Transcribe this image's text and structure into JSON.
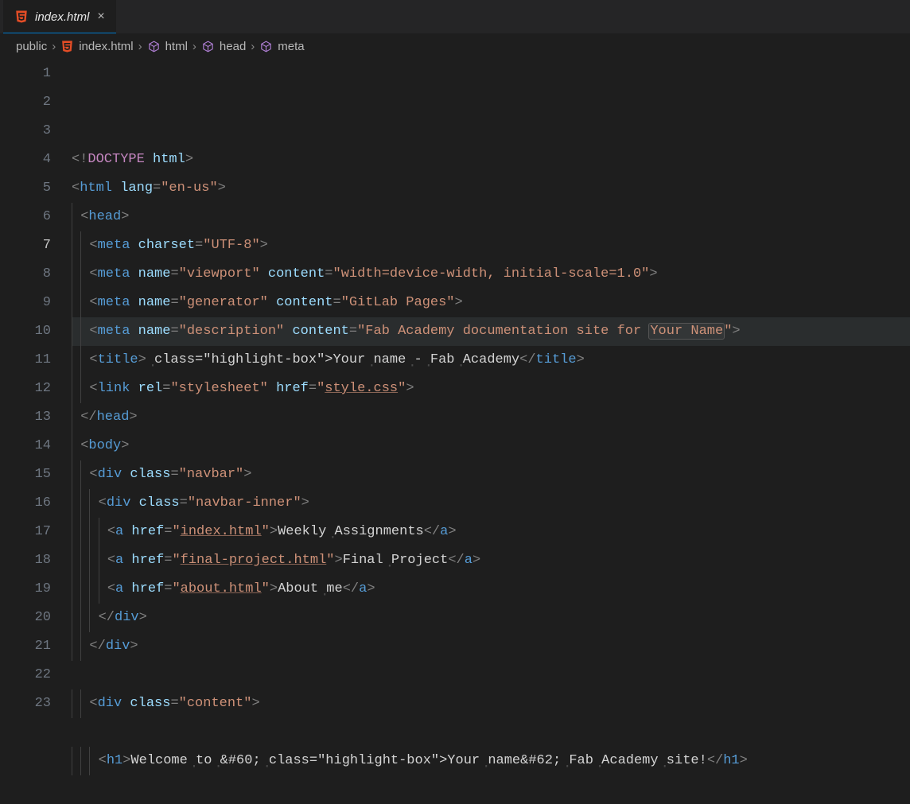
{
  "tabs": [
    {
      "name": "index.html"
    }
  ],
  "breadcrumb": [
    {
      "label": "public",
      "icon": null
    },
    {
      "label": "index.html",
      "icon": "html5"
    },
    {
      "label": "html",
      "icon": "cube"
    },
    {
      "label": "head",
      "icon": "cube"
    },
    {
      "label": "meta",
      "icon": "cube"
    }
  ],
  "gutter": [
    "1",
    "2",
    "3",
    "4",
    "5",
    "6",
    "7",
    "8",
    "9",
    "10",
    "11",
    "12",
    "13",
    "14",
    "15",
    "16",
    "17",
    "18",
    "19",
    "20",
    "21",
    "22",
    "23"
  ],
  "code": {
    "l1": {
      "raw": "<!DOCTYPE html>"
    },
    "l2": {
      "raw": "<html lang=\"en-us\">"
    },
    "l3": {
      "raw": "  <head>"
    },
    "l4": {
      "raw": "    <meta charset=\"UTF-8\">"
    },
    "l5": {
      "raw": "    <meta name=\"viewport\" content=\"width=device-width, initial-scale=1.0\">"
    },
    "l6": {
      "raw": "    <meta name=\"generator\" content=\"GitLab Pages\">"
    },
    "l7": {
      "raw": "    <meta name=\"description\" content=\"Fab Academy documentation site for Your Name\">",
      "highlight_text": "Your Name"
    },
    "l8": {
      "raw": "    <title>Your name - Fab Academy</title>",
      "highlight_text": "Your name"
    },
    "l9": {
      "raw": "    <link rel=\"stylesheet\" href=\"style.css\">",
      "link_text": "style.css"
    },
    "l10": {
      "raw": "  </head>"
    },
    "l11": {
      "raw": "  <body>"
    },
    "l12": {
      "raw": "    <div class=\"navbar\">"
    },
    "l13": {
      "raw": "      <div class=\"navbar-inner\">"
    },
    "l14": {
      "raw": "        <a href=\"index.html\">Weekly Assignments</a>",
      "link_text": "index.html"
    },
    "l15": {
      "raw": "        <a href=\"final-project.html\">Final Project</a>",
      "link_text": "final-project.html"
    },
    "l16": {
      "raw": "        <a href=\"about.html\">About me</a>",
      "link_text": "about.html"
    },
    "l17": {
      "raw": "      </div>"
    },
    "l18": {
      "raw": "    </div>"
    },
    "l19": {
      "raw": ""
    },
    "l20": {
      "raw": "    <div class=\"content\">"
    },
    "l21": {
      "raw": ""
    },
    "l22": {
      "raw": "      <h1>Welcome to &#60;Your name&#62; Fab Academy site!</h1>",
      "highlight_text": "Your name"
    },
    "l23": {
      "raw": ""
    }
  },
  "active_line": 7
}
